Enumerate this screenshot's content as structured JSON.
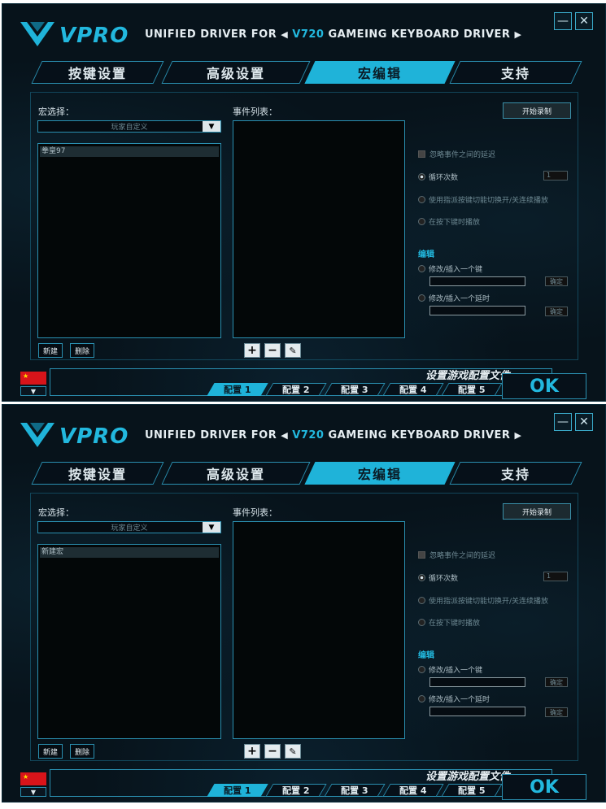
{
  "header": {
    "brand": "VPRO",
    "title_prefix": "UNIFIED DRIVER FOR",
    "model": "V720",
    "title_suffix": "GAMEING KEYBOARD DRIVER"
  },
  "window_controls": {
    "minimize": "—",
    "close": "✕"
  },
  "tabs": [
    {
      "label": "按键设置"
    },
    {
      "label": "高级设置"
    },
    {
      "label": "宏编辑"
    },
    {
      "label": "支持"
    }
  ],
  "macro": {
    "select_label": "宏选择：",
    "dropdown_value": "玩家自定义",
    "event_list_label": "事件列表：",
    "new_button": "新建",
    "delete_button": "删除",
    "record_button": "开始录制"
  },
  "options": {
    "ignore_delay": "忽略事件之间的延迟",
    "loop_count": "循环次数",
    "loop_count_value": "1",
    "toggle_play": "使用指派按键切能切换开/关连续播放",
    "hold_play": "在按下键时播放",
    "edit_label": "编辑",
    "modify_key": "修改/插入一个键",
    "modify_delay": "修改/插入一个延时",
    "confirm": "确定"
  },
  "footer": {
    "profile_label": "设置游戏配置文件",
    "configs": [
      "配置 1",
      "配置 2",
      "配置 3",
      "配置 4",
      "配置 5"
    ],
    "ok": "OK",
    "flag_star": "★",
    "flag_dropdown": "▼"
  },
  "screens": [
    {
      "list_items": [
        "拳皇97"
      ]
    },
    {
      "list_items": [
        "新建宏"
      ]
    }
  ],
  "colors": {
    "accent": "#1fb3d9",
    "background": "#07131b"
  }
}
